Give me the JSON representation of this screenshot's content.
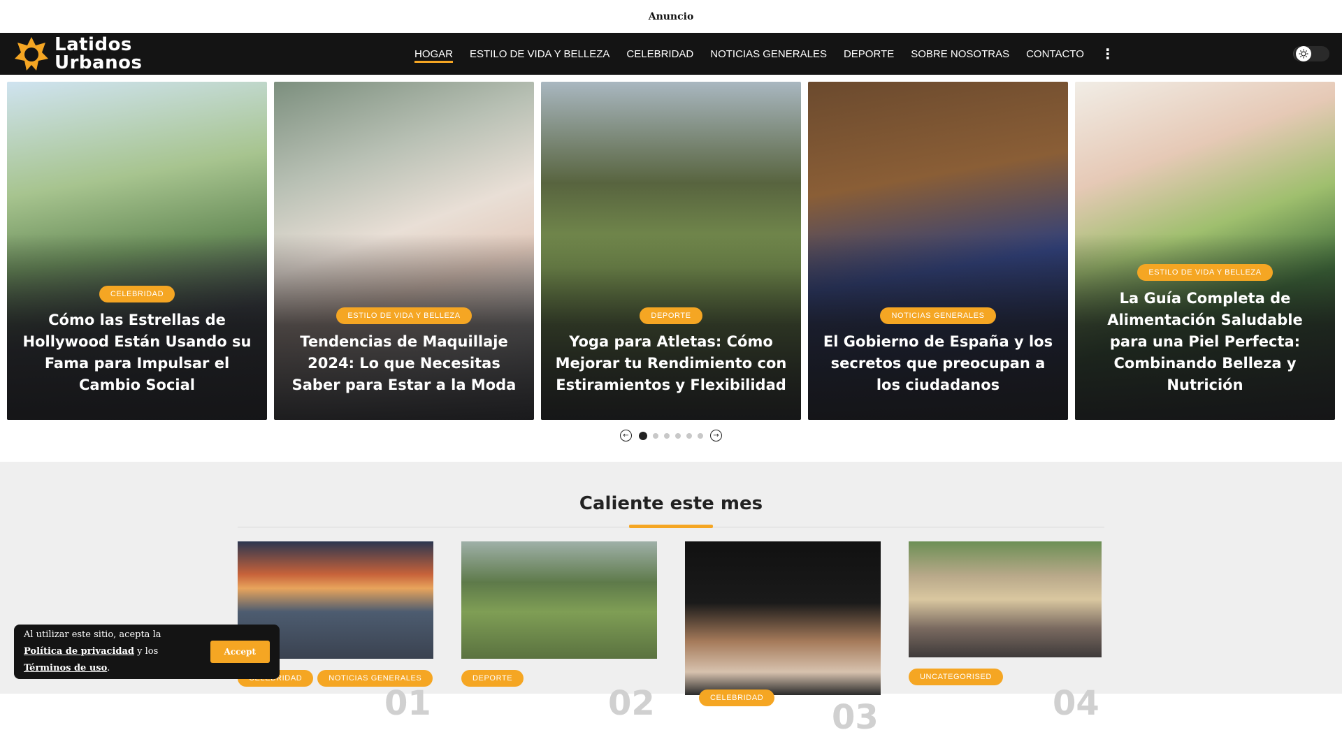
{
  "ad": {
    "label": "Anuncio"
  },
  "brand": {
    "line1": "Latidos",
    "line2": "Urbanos"
  },
  "nav": {
    "items": [
      {
        "label": "HOGAR"
      },
      {
        "label": "ESTILO DE VIDA Y BELLEZA"
      },
      {
        "label": "CELEBRIDAD"
      },
      {
        "label": "NOTICIAS GENERALES"
      },
      {
        "label": "DEPORTE"
      },
      {
        "label": "SOBRE NOSOTRAS"
      },
      {
        "label": "CONTACTO"
      }
    ],
    "more_icon": "vertical-dots-icon",
    "theme_icon": "sun-icon"
  },
  "slides": [
    {
      "category": "CELEBRIDAD",
      "title": "Cómo las Estrellas de Hollywood Están Usando su Fama para Impulsar el Cambio Social"
    },
    {
      "category": "ESTILO DE VIDA Y BELLEZA",
      "title": "Tendencias de Maquillaje 2024: Lo que Necesitas Saber para Estar a la Moda"
    },
    {
      "category": "DEPORTE",
      "title": "Yoga para Atletas: Cómo Mejorar tu Rendimiento con Estiramientos y Flexibilidad"
    },
    {
      "category": "NOTICIAS GENERALES",
      "title": "El Gobierno de España y los secretos que preocupan a los ciudadanos"
    },
    {
      "category": "ESTILO DE VIDA Y BELLEZA",
      "title": "La Guía Completa de Alimentación Saludable para una Piel Perfecta: Combinando Belleza y Nutrición"
    }
  ],
  "pager": {
    "total": 6,
    "active": 1
  },
  "hot": {
    "title": "Caliente este mes",
    "cards": [
      {
        "badges": [
          "CELEBRIDAD",
          "NOTICIAS GENERALES"
        ],
        "num": "01"
      },
      {
        "badges": [
          "DEPORTE"
        ],
        "num": "02"
      },
      {
        "badges": [
          "CELEBRIDAD"
        ],
        "num": "03"
      },
      {
        "badges": [
          "UNCATEGORISED"
        ],
        "num": "04"
      }
    ]
  },
  "cookie": {
    "text1": "Al utilizar este sitio, acepta la ",
    "link1": "Política de privacidad",
    "text2": " y los ",
    "link2": "Términos de uso",
    "text3": ".",
    "accept": "Accept"
  },
  "colors": {
    "accent": "#f5a623",
    "header_bg": "#141414",
    "section_bg": "#efefef"
  }
}
